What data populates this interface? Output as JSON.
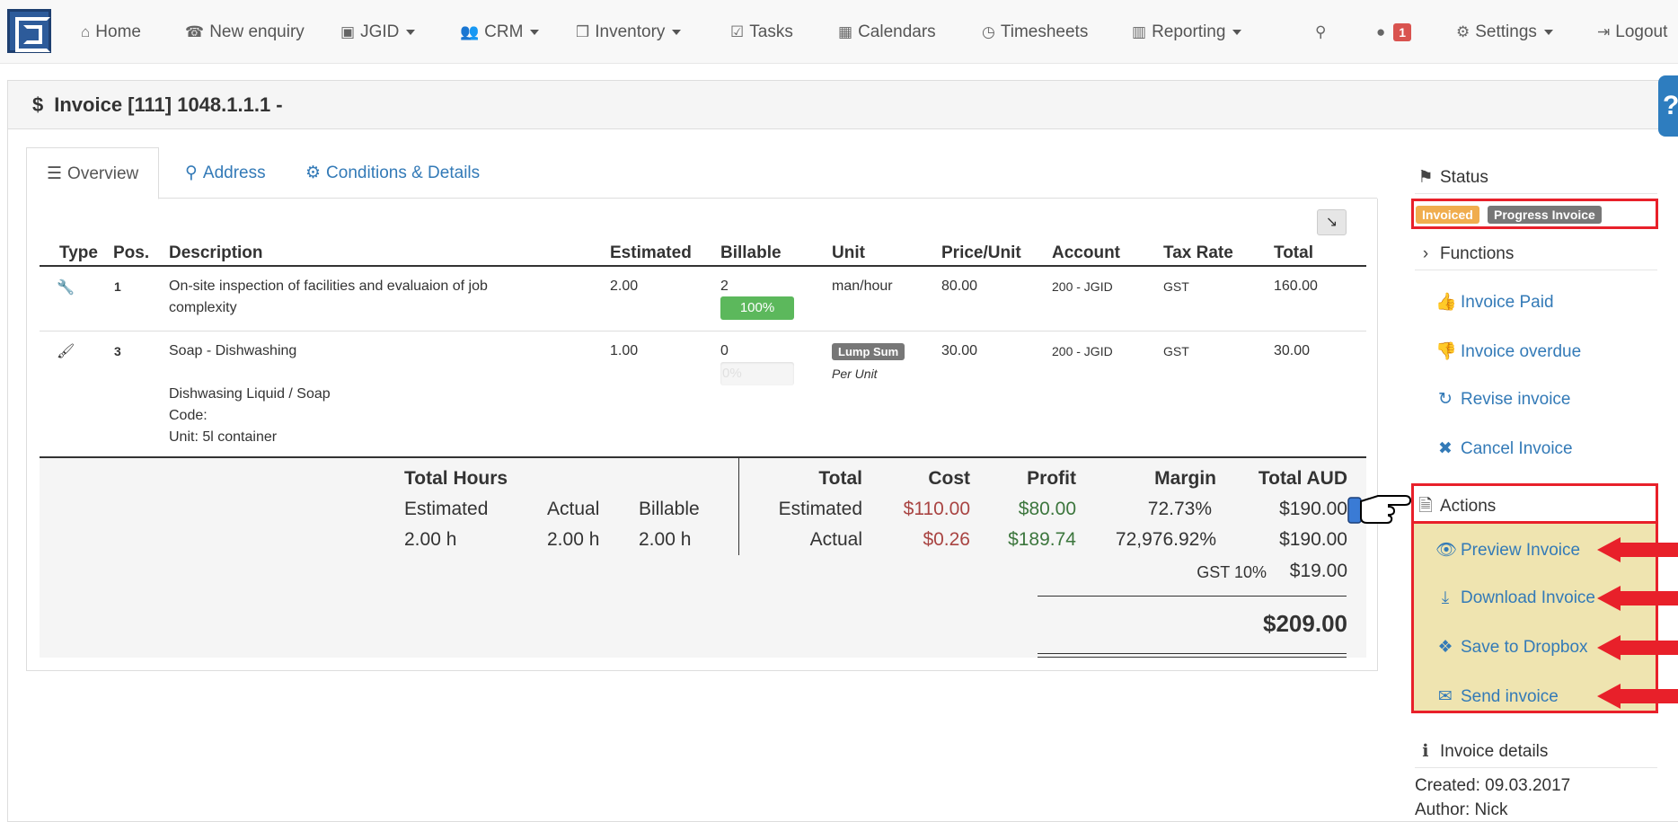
{
  "navbar": {
    "items": [
      {
        "label": "Home",
        "icon": "home-icon",
        "glyph": "⌂"
      },
      {
        "label": "New enquiry",
        "icon": "phone-icon",
        "glyph": "☎"
      },
      {
        "label": "JGID",
        "icon": "logo-small-icon",
        "glyph": "▣"
      },
      {
        "label": "CRM",
        "icon": "users-icon",
        "glyph": "👥"
      },
      {
        "label": "Inventory",
        "icon": "cubes-icon",
        "glyph": "❒"
      },
      {
        "label": "Tasks",
        "icon": "check-square-icon",
        "glyph": "☑"
      },
      {
        "label": "Calendars",
        "icon": "calendar-icon",
        "glyph": "▦"
      },
      {
        "label": "Timesheets",
        "icon": "clock-icon",
        "glyph": "◷"
      },
      {
        "label": "Reporting",
        "icon": "bar-chart-icon",
        "glyph": "▥"
      },
      {
        "label": "Settings",
        "icon": "gear-icon",
        "glyph": "⚙"
      },
      {
        "label": "Logout",
        "icon": "logout-icon",
        "glyph": "⇥"
      }
    ],
    "notification_count": "1"
  },
  "page": {
    "title": "Invoice [111] 1048.1.1.1 -",
    "title_glyph": "$",
    "help_glyph": "?"
  },
  "tabs": [
    {
      "label": "Overview",
      "glyph": "☰"
    },
    {
      "label": "Address",
      "glyph": "⚲"
    },
    {
      "label": "Conditions & Details",
      "glyph": "⚙"
    }
  ],
  "table": {
    "headers": [
      "Type",
      "Pos.",
      "Description",
      "Estimated",
      "Billable",
      "Unit",
      "Price/Unit",
      "Account",
      "Tax Rate",
      "Total"
    ],
    "rows": [
      {
        "type_icon": "wrench-icon",
        "pos": "1",
        "description": "On-site inspection of facilities and evaluaion of job complexity",
        "estimated": "2.00",
        "billable": "2",
        "billable_progress": "100%",
        "billable_fraction": 1.0,
        "unit": "man/hour",
        "price_unit": "80.00",
        "account": "200 - JGID",
        "tax_rate": "GST",
        "total": "160.00"
      },
      {
        "type_icon": "brush-icon",
        "pos": "3",
        "description": "Soap - Dishwashing",
        "description_extra": [
          "Dishwasing Liquid / Soap",
          "Code:",
          "Unit: 5l container"
        ],
        "estimated": "1.00",
        "billable": "0",
        "billable_progress": "0%",
        "billable_fraction": 0.0,
        "unit_badge": "Lump Sum",
        "unit_sub": "Per Unit",
        "price_unit": "30.00",
        "account": "200 - JGID",
        "tax_rate": "GST",
        "total": "30.00"
      }
    ]
  },
  "summary": {
    "hours_title": "Total Hours",
    "hours_cols": [
      "Estimated",
      "Actual",
      "Billable"
    ],
    "hours_vals": [
      "2.00 h",
      "2.00 h",
      "2.00 h"
    ],
    "fin_headers": [
      "Total",
      "Cost",
      "Profit",
      "Margin",
      "Total AUD"
    ],
    "estimated": {
      "label": "Estimated",
      "cost": "$110.00",
      "profit": "$80.00",
      "margin": "72.73%",
      "total": "$190.00"
    },
    "actual": {
      "label": "Actual",
      "cost": "$0.26",
      "profit": "$189.74",
      "margin": "72,976.92%",
      "total": "$190.00"
    },
    "tax_label": "GST 10%",
    "tax_value": "$19.00",
    "grand_total": "$209.00"
  },
  "sidebar": {
    "status_title": "Status",
    "status_labels": [
      "Invoiced",
      "Progress Invoice"
    ],
    "functions_title": "Functions",
    "functions": [
      {
        "label": "Invoice Paid",
        "icon": "thumbs-up-icon",
        "glyph": "👍"
      },
      {
        "label": "Invoice overdue",
        "icon": "thumbs-down-icon",
        "glyph": "👎"
      },
      {
        "label": "Revise invoice",
        "icon": "refresh-icon",
        "glyph": "↻"
      },
      {
        "label": "Cancel Invoice",
        "icon": "close-icon",
        "glyph": "✖"
      }
    ],
    "actions_title": "Actions",
    "actions": [
      {
        "label": "Preview Invoice",
        "icon": "eye-icon",
        "glyph": "👁"
      },
      {
        "label": "Download Invoice",
        "icon": "download-icon",
        "glyph": "⤓"
      },
      {
        "label": "Save to Dropbox",
        "icon": "dropbox-icon",
        "glyph": "❖"
      },
      {
        "label": "Send invoice",
        "icon": "envelope-icon",
        "glyph": "✉"
      }
    ],
    "details_title": "Invoice details",
    "created": "Created: 09.03.2017",
    "author": "Author: Nick"
  },
  "colors": {
    "link": "#337ab7",
    "highlight_border": "#e8202a",
    "actions_bg": "#efe4b0",
    "cost_red": "#a94442",
    "profit_green": "#3c763d",
    "progress_green": "#5cb85c",
    "invoiced_orange": "#f0ad4e"
  }
}
